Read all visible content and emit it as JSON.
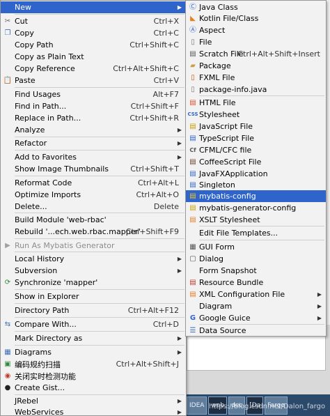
{
  "left_menu": {
    "items": [
      {
        "label": "New",
        "shortcut": "",
        "submenu": true,
        "icon": "",
        "selected": true
      },
      {
        "label": "Cut",
        "shortcut": "Ctrl+X",
        "icon": "cut-icon"
      },
      {
        "label": "Copy",
        "shortcut": "Ctrl+C",
        "icon": "copy-icon"
      },
      {
        "label": "Copy Path",
        "shortcut": "Ctrl+Shift+C",
        "icon": ""
      },
      {
        "label": "Copy as Plain Text",
        "shortcut": "",
        "icon": ""
      },
      {
        "label": "Copy Reference",
        "shortcut": "Ctrl+Alt+Shift+C",
        "icon": ""
      },
      {
        "label": "Paste",
        "shortcut": "Ctrl+V",
        "icon": "paste-icon"
      },
      {
        "label": "Find Usages",
        "shortcut": "Alt+F7",
        "icon": ""
      },
      {
        "label": "Find in Path...",
        "shortcut": "Ctrl+Shift+F",
        "icon": ""
      },
      {
        "label": "Replace in Path...",
        "shortcut": "Ctrl+Shift+R",
        "icon": ""
      },
      {
        "label": "Analyze",
        "shortcut": "",
        "submenu": true,
        "icon": ""
      },
      {
        "label": "Refactor",
        "shortcut": "",
        "submenu": true,
        "icon": ""
      },
      {
        "label": "Add to Favorites",
        "shortcut": "",
        "submenu": true,
        "icon": ""
      },
      {
        "label": "Show Image Thumbnails",
        "shortcut": "Ctrl+Shift+T",
        "icon": ""
      },
      {
        "label": "Reformat Code",
        "shortcut": "Ctrl+Alt+L",
        "icon": ""
      },
      {
        "label": "Optimize Imports",
        "shortcut": "Ctrl+Alt+O",
        "icon": ""
      },
      {
        "label": "Delete...",
        "shortcut": "Delete",
        "icon": ""
      },
      {
        "label": "Build Module 'web-rbac'",
        "shortcut": "",
        "icon": ""
      },
      {
        "label": "Rebuild '...ech.web.rbac.mapper'",
        "shortcut": "Ctrl+Shift+F9",
        "icon": ""
      },
      {
        "label": "Run As Mybatis Generator",
        "shortcut": "",
        "icon": "mybatis-icon",
        "disabled": true
      },
      {
        "label": "Local History",
        "shortcut": "",
        "submenu": true,
        "icon": ""
      },
      {
        "label": "Subversion",
        "shortcut": "",
        "submenu": true,
        "icon": ""
      },
      {
        "label": "Synchronize 'mapper'",
        "shortcut": "",
        "icon": "sync-icon"
      },
      {
        "label": "Show in Explorer",
        "shortcut": "",
        "icon": ""
      },
      {
        "label": "Directory Path",
        "shortcut": "Ctrl+Alt+F12",
        "icon": ""
      },
      {
        "label": "Compare With...",
        "shortcut": "Ctrl+D",
        "icon": "compare-icon"
      },
      {
        "label": "Mark Directory as",
        "shortcut": "",
        "submenu": true,
        "icon": ""
      },
      {
        "label": "Diagrams",
        "shortcut": "",
        "submenu": true,
        "icon": "diagram-icon"
      },
      {
        "label": "编码规约扫描",
        "shortcut": "Ctrl+Alt+Shift+J",
        "icon": "scan-icon"
      },
      {
        "label": "关闭实时检测功能",
        "shortcut": "",
        "icon": "realtime-icon"
      },
      {
        "label": "Create Gist...",
        "shortcut": "",
        "icon": "github-icon"
      },
      {
        "label": "JRebel",
        "shortcut": "",
        "submenu": true,
        "icon": ""
      },
      {
        "label": "WebServices",
        "shortcut": "",
        "submenu": true,
        "icon": ""
      }
    ]
  },
  "right_menu": {
    "items": [
      {
        "label": "Java Class",
        "shortcut": "",
        "icon": "java-class-icon"
      },
      {
        "label": "Kotlin File/Class",
        "shortcut": "",
        "icon": "kotlin-icon"
      },
      {
        "label": "Aspect",
        "shortcut": "",
        "icon": "aspect-icon"
      },
      {
        "label": "File",
        "shortcut": "",
        "icon": "file-icon"
      },
      {
        "label": "Scratch File",
        "shortcut": "Ctrl+Alt+Shift+Insert",
        "icon": "scratch-icon"
      },
      {
        "label": "Package",
        "shortcut": "",
        "icon": "package-icon"
      },
      {
        "label": "FXML File",
        "shortcut": "",
        "icon": "fxml-icon"
      },
      {
        "label": "package-info.java",
        "shortcut": "",
        "icon": "package-info-icon"
      },
      {
        "label": "HTML File",
        "shortcut": "",
        "icon": "html-icon"
      },
      {
        "label": "Stylesheet",
        "shortcut": "",
        "icon": "css-icon"
      },
      {
        "label": "JavaScript File",
        "shortcut": "",
        "icon": "js-icon"
      },
      {
        "label": "TypeScript File",
        "shortcut": "",
        "icon": "ts-icon"
      },
      {
        "label": "CFML/CFC file",
        "shortcut": "",
        "icon": "cfml-icon"
      },
      {
        "label": "CoffeeScript File",
        "shortcut": "",
        "icon": "coffee-icon"
      },
      {
        "label": "JavaFXApplication",
        "shortcut": "",
        "icon": "javafx-icon"
      },
      {
        "label": "Singleton",
        "shortcut": "",
        "icon": "singleton-icon"
      },
      {
        "label": "mybatis-config",
        "shortcut": "",
        "icon": "mybatis-config-icon",
        "selected": true
      },
      {
        "label": "mybatis-generator-config",
        "shortcut": "",
        "icon": "mybatis-generator-icon"
      },
      {
        "label": "XSLT Stylesheet",
        "shortcut": "",
        "icon": "xslt-icon"
      },
      {
        "label": "Edit File Templates...",
        "shortcut": "",
        "icon": ""
      },
      {
        "label": "GUI Form",
        "shortcut": "",
        "icon": "gui-form-icon"
      },
      {
        "label": "Dialog",
        "shortcut": "",
        "icon": "dialog-icon"
      },
      {
        "label": "Form Snapshot",
        "shortcut": "",
        "icon": ""
      },
      {
        "label": "Resource Bundle",
        "shortcut": "",
        "icon": "resource-bundle-icon"
      },
      {
        "label": "XML Configuration File",
        "shortcut": "",
        "submenu": true,
        "icon": "xml-icon"
      },
      {
        "label": "Diagram",
        "shortcut": "",
        "submenu": true,
        "icon": ""
      },
      {
        "label": "Google Guice",
        "shortcut": "",
        "submenu": true,
        "icon": "guice-icon"
      },
      {
        "label": "Data Source",
        "shortcut": "",
        "icon": "data-source-icon"
      }
    ]
  },
  "taskbar": {
    "items": [
      "IDEA",
      "web",
      "dec",
      "[Da",
      "Fargo"
    ],
    "watermark": "https://blog.csdn.net/Dalon_fargo"
  },
  "colors": {
    "selection": "#2f65ca",
    "menu_bg": "#f2f2f2"
  }
}
